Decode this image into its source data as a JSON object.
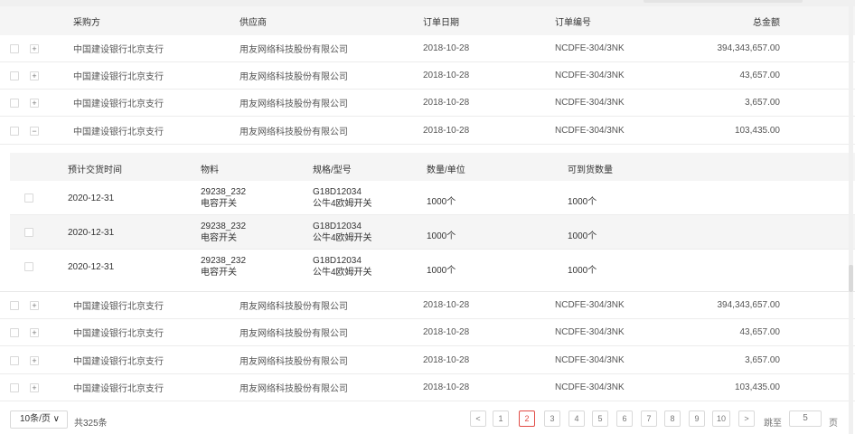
{
  "header": {
    "buyer": "采购方",
    "supplier": "供应商",
    "order_date": "订单日期",
    "order_no": "订单编号",
    "total": "总金额"
  },
  "orders_top": [
    {
      "buyer": "中国建设银行北京支行",
      "supplier": "用友网络科技股份有限公司",
      "date": "2018-10-28",
      "no": "NCDFE-304/3NK",
      "total": "394,343,657.00",
      "expand": "+"
    },
    {
      "buyer": "中国建设银行北京支行",
      "supplier": "用友网络科技股份有限公司",
      "date": "2018-10-28",
      "no": "NCDFE-304/3NK",
      "total": "43,657.00",
      "expand": "+"
    },
    {
      "buyer": "中国建设银行北京支行",
      "supplier": "用友网络科技股份有限公司",
      "date": "2018-10-28",
      "no": "NCDFE-304/3NK",
      "total": "3,657.00",
      "expand": "+"
    },
    {
      "buyer": "中国建设银行北京支行",
      "supplier": "用友网络科技股份有限公司",
      "date": "2018-10-28",
      "no": "NCDFE-304/3NK",
      "total": "103,435.00",
      "expand": "−"
    }
  ],
  "detail_header": {
    "delivery_time": "预计交货时间",
    "material": "物料",
    "spec": "规格/型号",
    "qty": "数量/单位",
    "arrivable": "可到货数量"
  },
  "detail_rows": [
    {
      "time": "2020-12-31",
      "material_code": "29238_232",
      "material_name": "电容开关",
      "spec_code": "G18D12034",
      "spec_name": "公牛4欧姆开关",
      "qty": "1000个",
      "arrivable": "1000个"
    },
    {
      "time": "2020-12-31",
      "material_code": "29238_232",
      "material_name": "电容开关",
      "spec_code": "G18D12034",
      "spec_name": "公牛4欧姆开关",
      "qty": "1000个",
      "arrivable": "1000个"
    },
    {
      "time": "2020-12-31",
      "material_code": "29238_232",
      "material_name": "电容开关",
      "spec_code": "G18D12034",
      "spec_name": "公牛4欧姆开关",
      "qty": "1000个",
      "arrivable": "1000个"
    }
  ],
  "orders_bottom": [
    {
      "buyer": "中国建设银行北京支行",
      "supplier": "用友网络科技股份有限公司",
      "date": "2018-10-28",
      "no": "NCDFE-304/3NK",
      "total": "394,343,657.00",
      "expand": "+"
    },
    {
      "buyer": "中国建设银行北京支行",
      "supplier": "用友网络科技股份有限公司",
      "date": "2018-10-28",
      "no": "NCDFE-304/3NK",
      "total": "43,657.00",
      "expand": "+"
    },
    {
      "buyer": "中国建设银行北京支行",
      "supplier": "用友网络科技股份有限公司",
      "date": "2018-10-28",
      "no": "NCDFE-304/3NK",
      "total": "3,657.00",
      "expand": "+"
    },
    {
      "buyer": "中国建设银行北京支行",
      "supplier": "用友网络科技股份有限公司",
      "date": "2018-10-28",
      "no": "NCDFE-304/3NK",
      "total": "103,435.00",
      "expand": "+"
    }
  ],
  "pagination": {
    "page_size": "10条/页 ∨",
    "total": "共325条",
    "prev": "<",
    "next": ">",
    "pages": [
      "1",
      "2",
      "3",
      "4",
      "5",
      "6",
      "7",
      "8",
      "9",
      "10"
    ],
    "active_page": "2",
    "jump_label": "跳至",
    "jump_value": "5",
    "page_unit": "页"
  },
  "colors": {
    "accent": "#e14c46",
    "header_bg": "#f5f5f5",
    "border": "#d9d9d9"
  }
}
